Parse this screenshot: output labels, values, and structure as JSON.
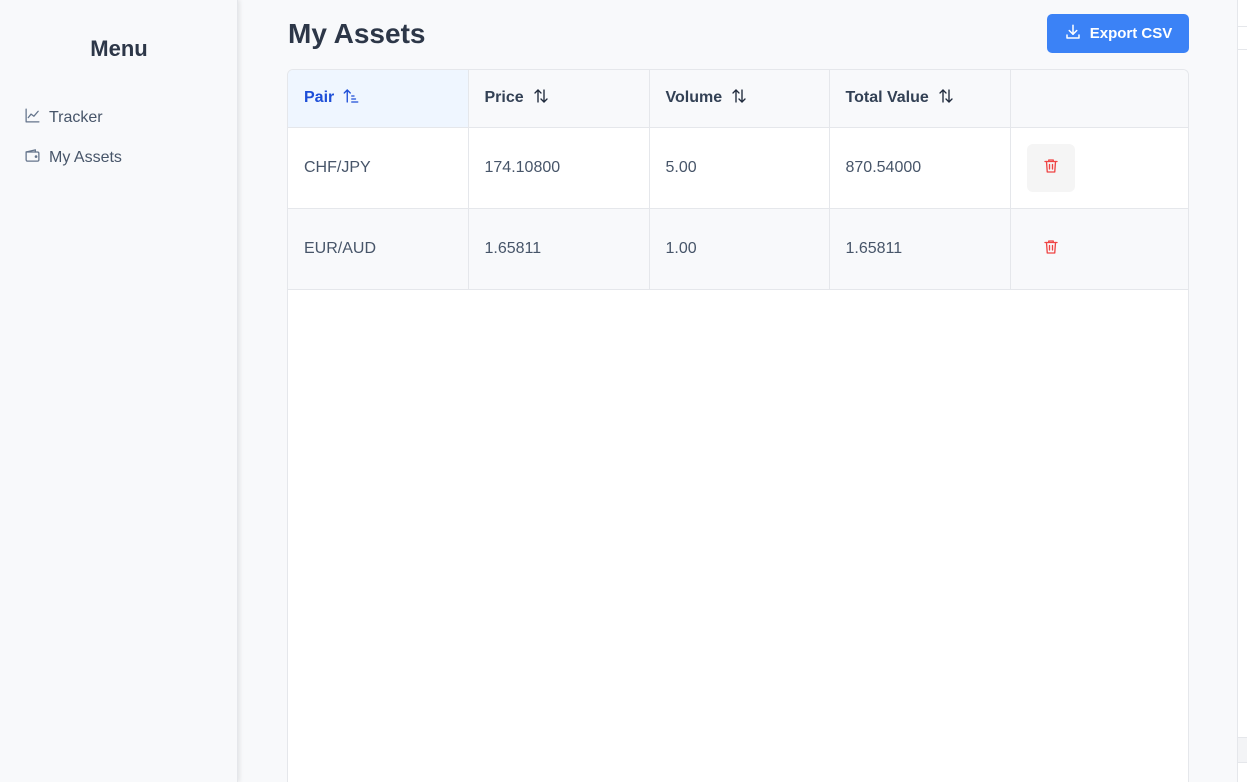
{
  "sidebar": {
    "title": "Menu",
    "items": [
      {
        "label": "Tracker",
        "icon": "chart-line-icon"
      },
      {
        "label": "My Assets",
        "icon": "wallet-icon"
      }
    ]
  },
  "header": {
    "title": "My Assets",
    "export_label": "Export CSV"
  },
  "table": {
    "columns": [
      {
        "label": "Pair",
        "sort": "ascending",
        "active": true
      },
      {
        "label": "Price",
        "sort": "none"
      },
      {
        "label": "Volume",
        "sort": "none"
      },
      {
        "label": "Total Value",
        "sort": "none"
      },
      {
        "label": ""
      }
    ],
    "rows": [
      {
        "pair": "CHF/JPY",
        "price": "174.10800",
        "volume": "5.00",
        "total": "870.54000"
      },
      {
        "pair": "EUR/AUD",
        "price": "1.65811",
        "volume": "1.00",
        "total": "1.65811"
      }
    ]
  },
  "colors": {
    "accent": "#3b82f6",
    "active_sort": "#1d4ed8",
    "delete": "#ef4444"
  }
}
